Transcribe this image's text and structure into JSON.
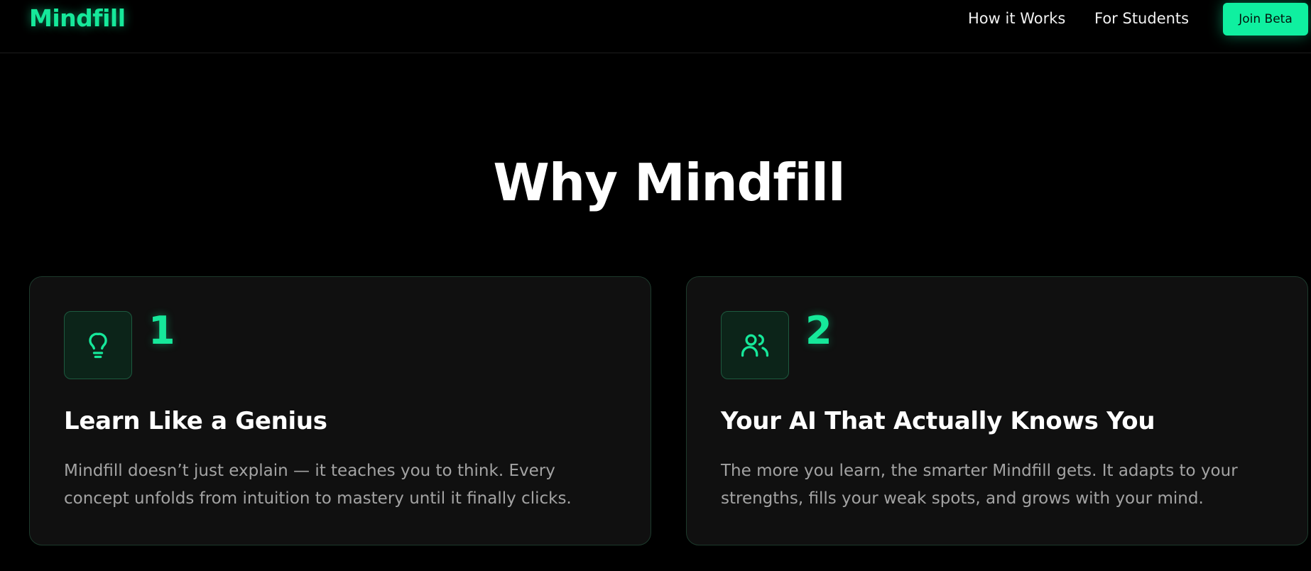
{
  "nav": {
    "brand": "Mindfill",
    "links": [
      "How it Works",
      "For Students"
    ],
    "cta_label": "Join Beta"
  },
  "section": {
    "title": "Why Mindfill"
  },
  "cards": [
    {
      "number": "1",
      "icon": "lightbulb-icon",
      "title": "Learn Like a Genius",
      "description": "Mindfill doesn’t just explain — it teaches you to think. Every concept unfolds from intuition to mastery until it finally clicks."
    },
    {
      "number": "2",
      "icon": "users-icon",
      "title": "Your AI That Actually Knows You",
      "description": "The more you learn, the smarter Mindfill gets. It adapts to your strengths, fills your weak spots, and grows with your mind."
    }
  ],
  "colors": {
    "background": "#000000",
    "accent": "#16e89a",
    "card_background": "#101010",
    "card_border": "#1d3a2c",
    "muted_text": "#a3a3a3"
  }
}
